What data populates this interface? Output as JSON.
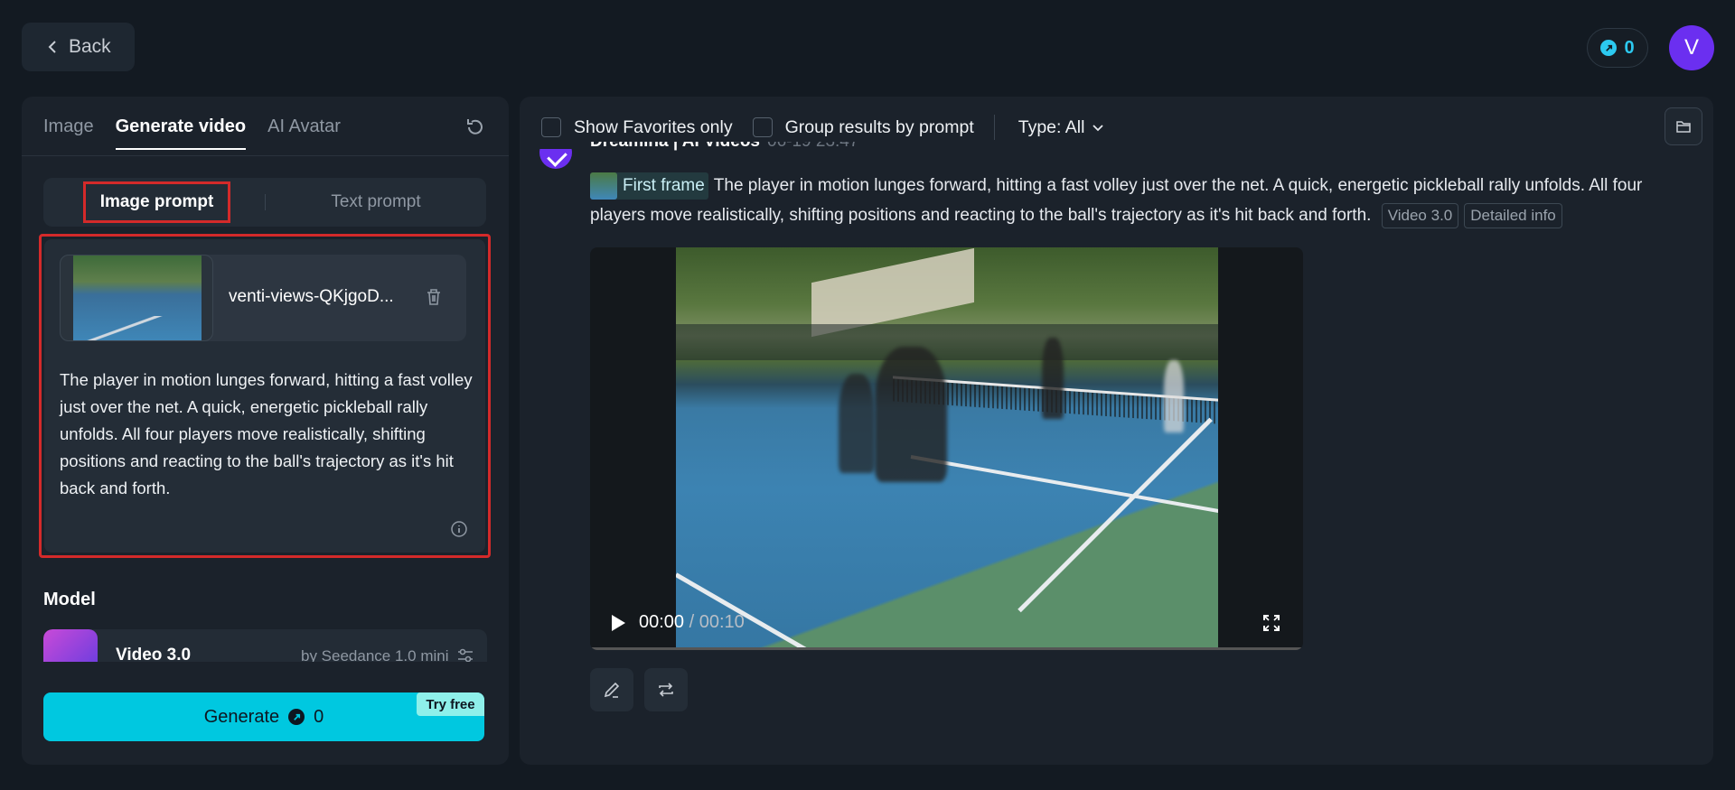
{
  "header": {
    "back_label": "Back",
    "credits": "0",
    "avatar_initial": "V"
  },
  "left_panel": {
    "tabs": [
      {
        "label": "Image",
        "active": false
      },
      {
        "label": "Generate video",
        "active": true
      },
      {
        "label": "AI Avatar",
        "active": false
      }
    ],
    "prompt_modes": {
      "image_prompt": "Image prompt",
      "text_prompt": "Text prompt",
      "selected": "Image prompt"
    },
    "uploaded_file": {
      "name": "venti-views-QKjgoD..."
    },
    "prompt_text": "The player in motion lunges forward, hitting a fast volley just over the net. A quick, energetic pickleball rally unfolds. All four players move realistically, shifting positions and reacting to the ball's trajectory as it's hit back and forth.",
    "model_section": {
      "label": "Model",
      "model_name": "Video 3.0",
      "model_by": "by Seedance 1.0 mini"
    },
    "generate": {
      "label": "Generate",
      "cost": "0",
      "badge": "Try free"
    }
  },
  "right_panel": {
    "filters": {
      "favorites_label": "Show Favorites only",
      "group_label": "Group results by prompt",
      "type_label": "Type: All"
    },
    "result": {
      "source": "Dreamina | AI Videos",
      "timestamp": "06-19  23:47",
      "first_frame_label": "First frame",
      "description": "The player in motion lunges forward, hitting a fast volley just over the net. A quick, energetic pickleball rally unfolds. All four players move realistically, shifting positions and reacting to the ball's trajectory as it's hit back and forth.",
      "model_badge": "Video 3.0",
      "info_badge": "Detailed info",
      "video": {
        "current_time": "00:00",
        "separator": "/",
        "duration": "00:10",
        "progress": 0
      }
    }
  },
  "colors": {
    "accent": "#00c8e0",
    "avatar": "#6b2ff0",
    "highlight_box": "#d42a2a"
  }
}
